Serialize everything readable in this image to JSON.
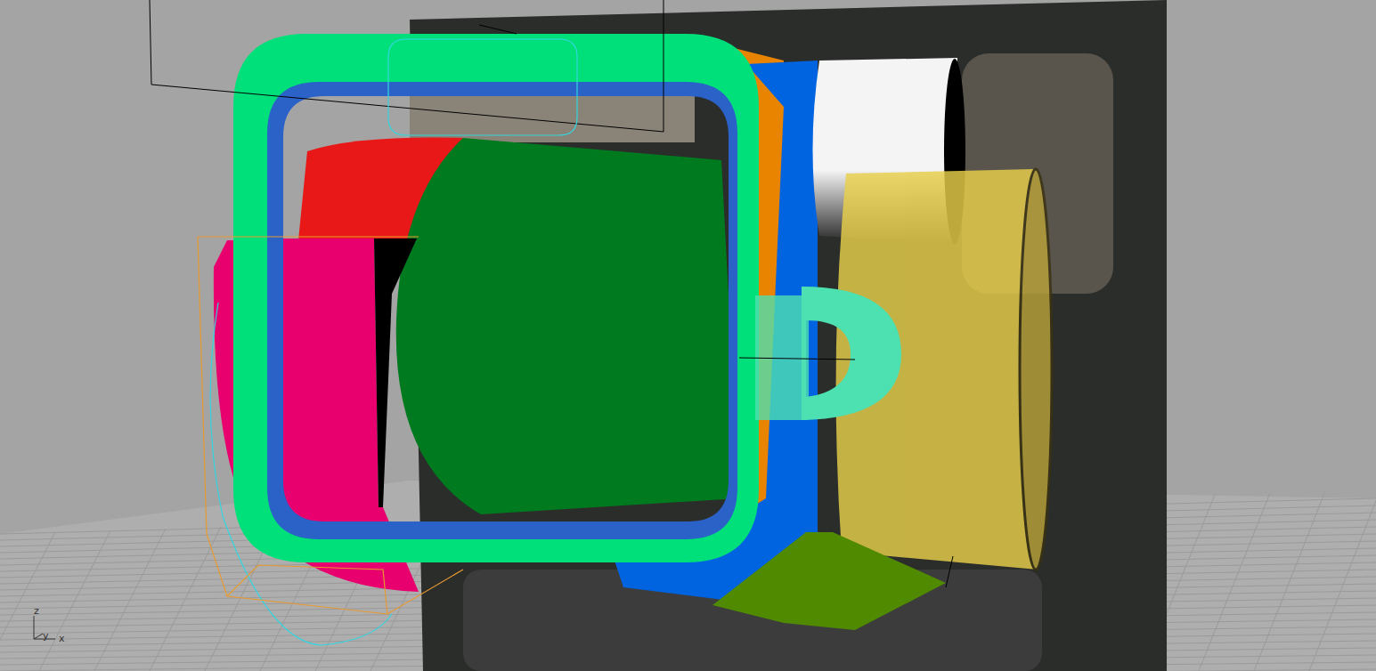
{
  "viewport": {
    "axes": [
      {
        "label": "z"
      },
      {
        "label": "y"
      },
      {
        "label": "x"
      }
    ]
  },
  "objects": [
    {
      "kind": "back-shell",
      "color": "#e98400"
    },
    {
      "kind": "back-plate",
      "color": "#0063e0"
    },
    {
      "kind": "top-cylinder",
      "color": "#e81818"
    },
    {
      "kind": "screen",
      "color": "#007a1f"
    },
    {
      "kind": "side-block",
      "color": "#e8006e"
    },
    {
      "kind": "inner-band",
      "color": "#2a62c8"
    },
    {
      "kind": "bezel",
      "color": "#00e07a"
    },
    {
      "kind": "side-cylinder",
      "color": "#f4f4f4"
    },
    {
      "kind": "lower-cylinder",
      "color": "#e8cf4a"
    },
    {
      "kind": "handle",
      "color": "#4de0b0"
    },
    {
      "kind": "base-plate",
      "color": "#4f8a00"
    }
  ]
}
